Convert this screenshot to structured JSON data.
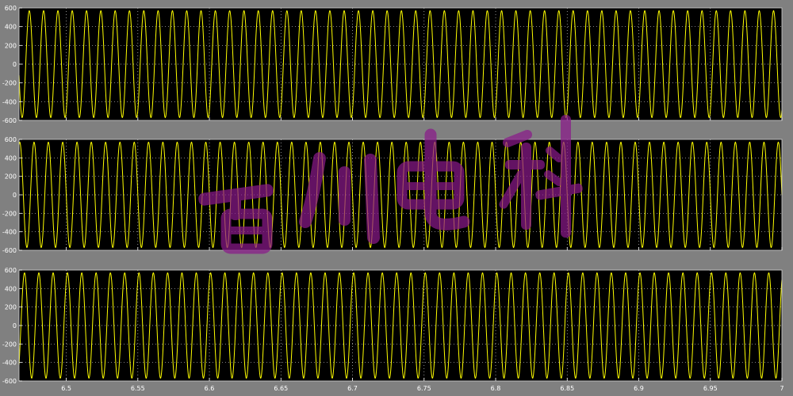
{
  "colors": {
    "background": "#808080",
    "plot_background": "#000000",
    "trace": "#ffff00",
    "grid": "#ffffff",
    "text": "#ffffff",
    "watermark": "#8a1a8a"
  },
  "watermark_text": "百川电科",
  "chart_data": [
    {
      "type": "line",
      "title": "",
      "xlabel": "",
      "ylabel": "",
      "xlim": [
        6.467,
        7.0
      ],
      "ylim": [
        -600,
        600
      ],
      "yticks": [
        -600,
        -400,
        -200,
        0,
        200,
        400,
        600
      ],
      "ytick_labels": [
        "-600",
        "-400",
        "-200",
        "0",
        "200",
        "400",
        "600"
      ],
      "xticks": [
        6.5,
        6.55,
        6.6,
        6.65,
        6.7,
        6.75,
        6.8,
        6.85,
        6.9,
        6.95,
        7.0
      ],
      "grid": true,
      "series": [
        {
          "function": "sine",
          "amplitude": 570,
          "frequency_hz": 100,
          "phase_deg": -60
        }
      ]
    },
    {
      "type": "line",
      "title": "",
      "xlabel": "",
      "ylabel": "",
      "xlim": [
        6.467,
        7.0
      ],
      "ylim": [
        -600,
        600
      ],
      "yticks": [
        -600,
        -400,
        -200,
        0,
        200,
        400,
        600
      ],
      "ytick_labels": [
        "-600",
        "-400",
        "-200",
        "0",
        "200",
        "400",
        "600"
      ],
      "xticks": [
        6.5,
        6.55,
        6.6,
        6.65,
        6.7,
        6.75,
        6.8,
        6.85,
        6.9,
        6.95,
        7.0
      ],
      "grid": true,
      "series": [
        {
          "function": "sine",
          "amplitude": 570,
          "frequency_hz": 100,
          "phase_deg": 180
        }
      ]
    },
    {
      "type": "line",
      "title": "",
      "xlabel": "",
      "ylabel": "",
      "xlim": [
        6.467,
        7.0
      ],
      "ylim": [
        -600,
        600
      ],
      "yticks": [
        -600,
        -400,
        -200,
        0,
        200,
        400,
        600
      ],
      "ytick_labels": [
        "-600",
        "-400",
        "-200",
        "0",
        "200",
        "400",
        "600"
      ],
      "xticks": [
        6.5,
        6.55,
        6.6,
        6.65,
        6.7,
        6.75,
        6.8,
        6.85,
        6.9,
        6.95,
        7.0
      ],
      "xtick_labels": [
        "6.5",
        "6.55",
        "6.6",
        "6.65",
        "6.7",
        "6.75",
        "6.8",
        "6.85",
        "6.9",
        "6.95",
        "7"
      ],
      "grid": true,
      "series": [
        {
          "function": "sine",
          "amplitude": 570,
          "frequency_hz": 100,
          "phase_deg": 60
        }
      ]
    }
  ]
}
